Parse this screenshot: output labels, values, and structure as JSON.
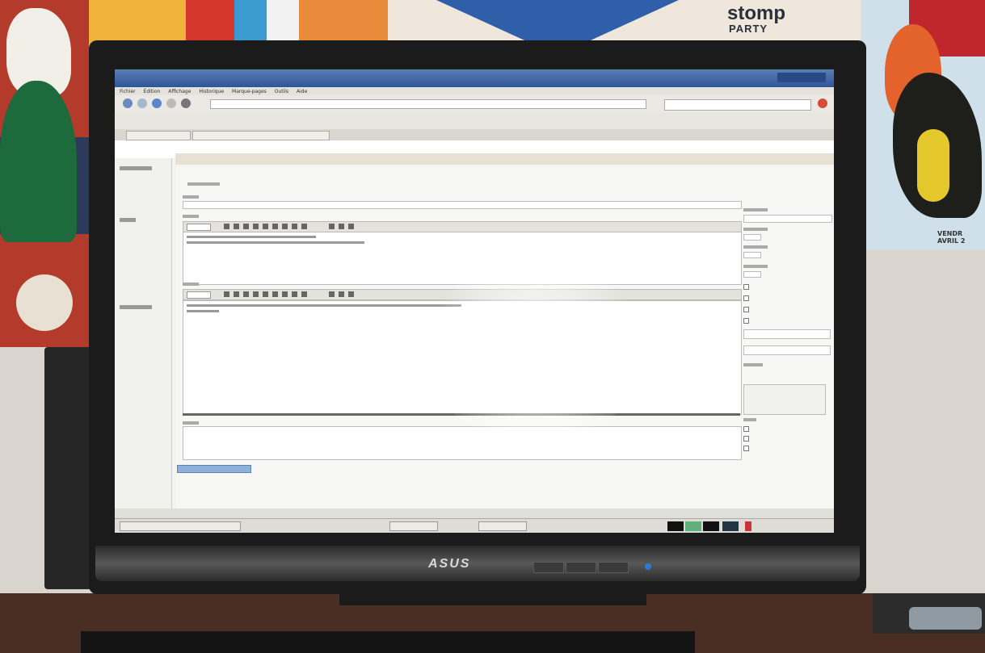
{
  "poster": {
    "brand_line1": "stomp",
    "brand_line2": "PARTY",
    "right_text_1": "VENDR",
    "right_text_2": "AVRIL 2"
  },
  "monitor": {
    "brand": "ASUS"
  },
  "browser": {
    "window_title": "",
    "menu": [
      "Fichier",
      "Édition",
      "Affichage",
      "Historique",
      "Marque-pages",
      "Outils",
      "Aide"
    ],
    "url": "",
    "bookmarks": [
      "",
      "",
      "",
      "",
      ""
    ],
    "tabs": [
      "",
      ""
    ]
  },
  "cms": {
    "logo": "",
    "page_title": "",
    "editor_text_1": "",
    "editor_text_2": "",
    "save_buttons": "",
    "sidebar_items": [
      "",
      "",
      "",
      "",
      "",
      "",
      "",
      "",
      "",
      "",
      "",
      "",
      "",
      "",
      "",
      "",
      ""
    ]
  },
  "taskbar": {
    "tasks": [
      "",
      "",
      ""
    ]
  }
}
